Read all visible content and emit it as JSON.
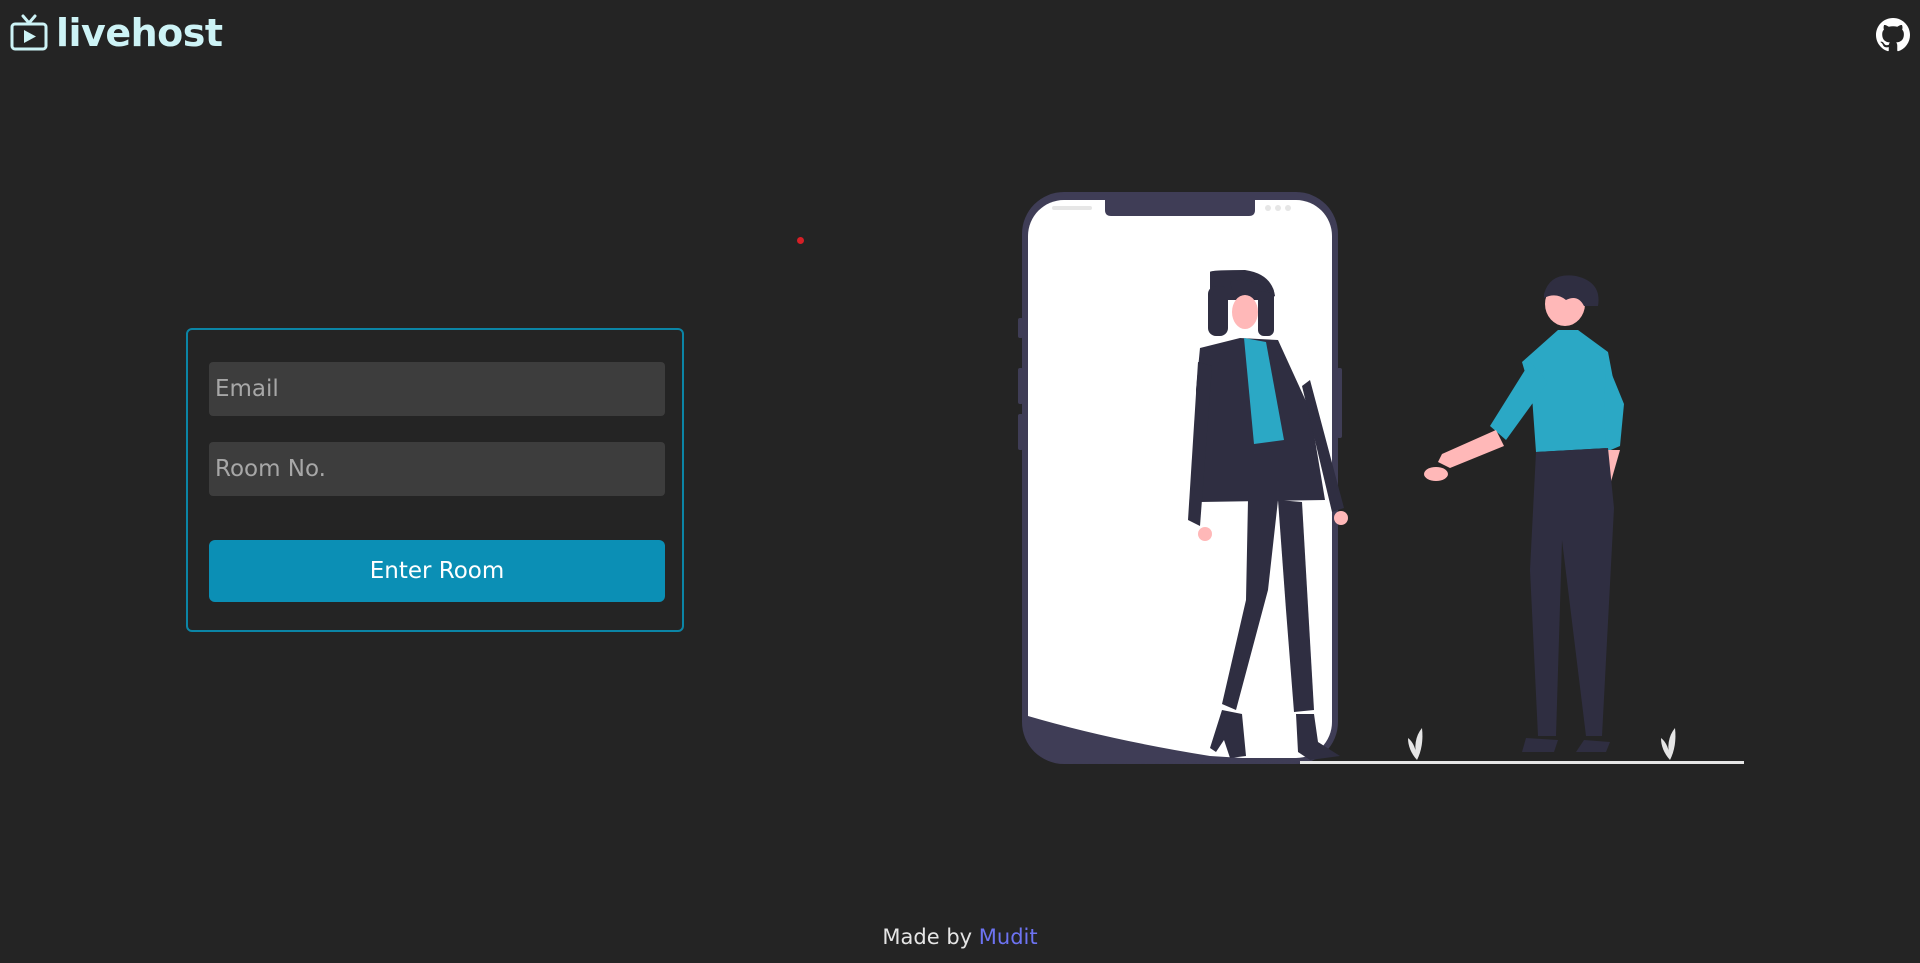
{
  "header": {
    "brand_name": "livehost",
    "brand_icon": "tv-icon",
    "brand_color": "#cdf3f6",
    "github_icon": "github-icon"
  },
  "form": {
    "email_placeholder": "Email",
    "email_value": "",
    "room_placeholder": "Room No.",
    "room_value": "",
    "submit_label": "Enter Room",
    "accent_color": "#0b8fb5"
  },
  "footer": {
    "prefix": "Made by ",
    "author": "Mudit",
    "link_color": "#6d73f2"
  }
}
